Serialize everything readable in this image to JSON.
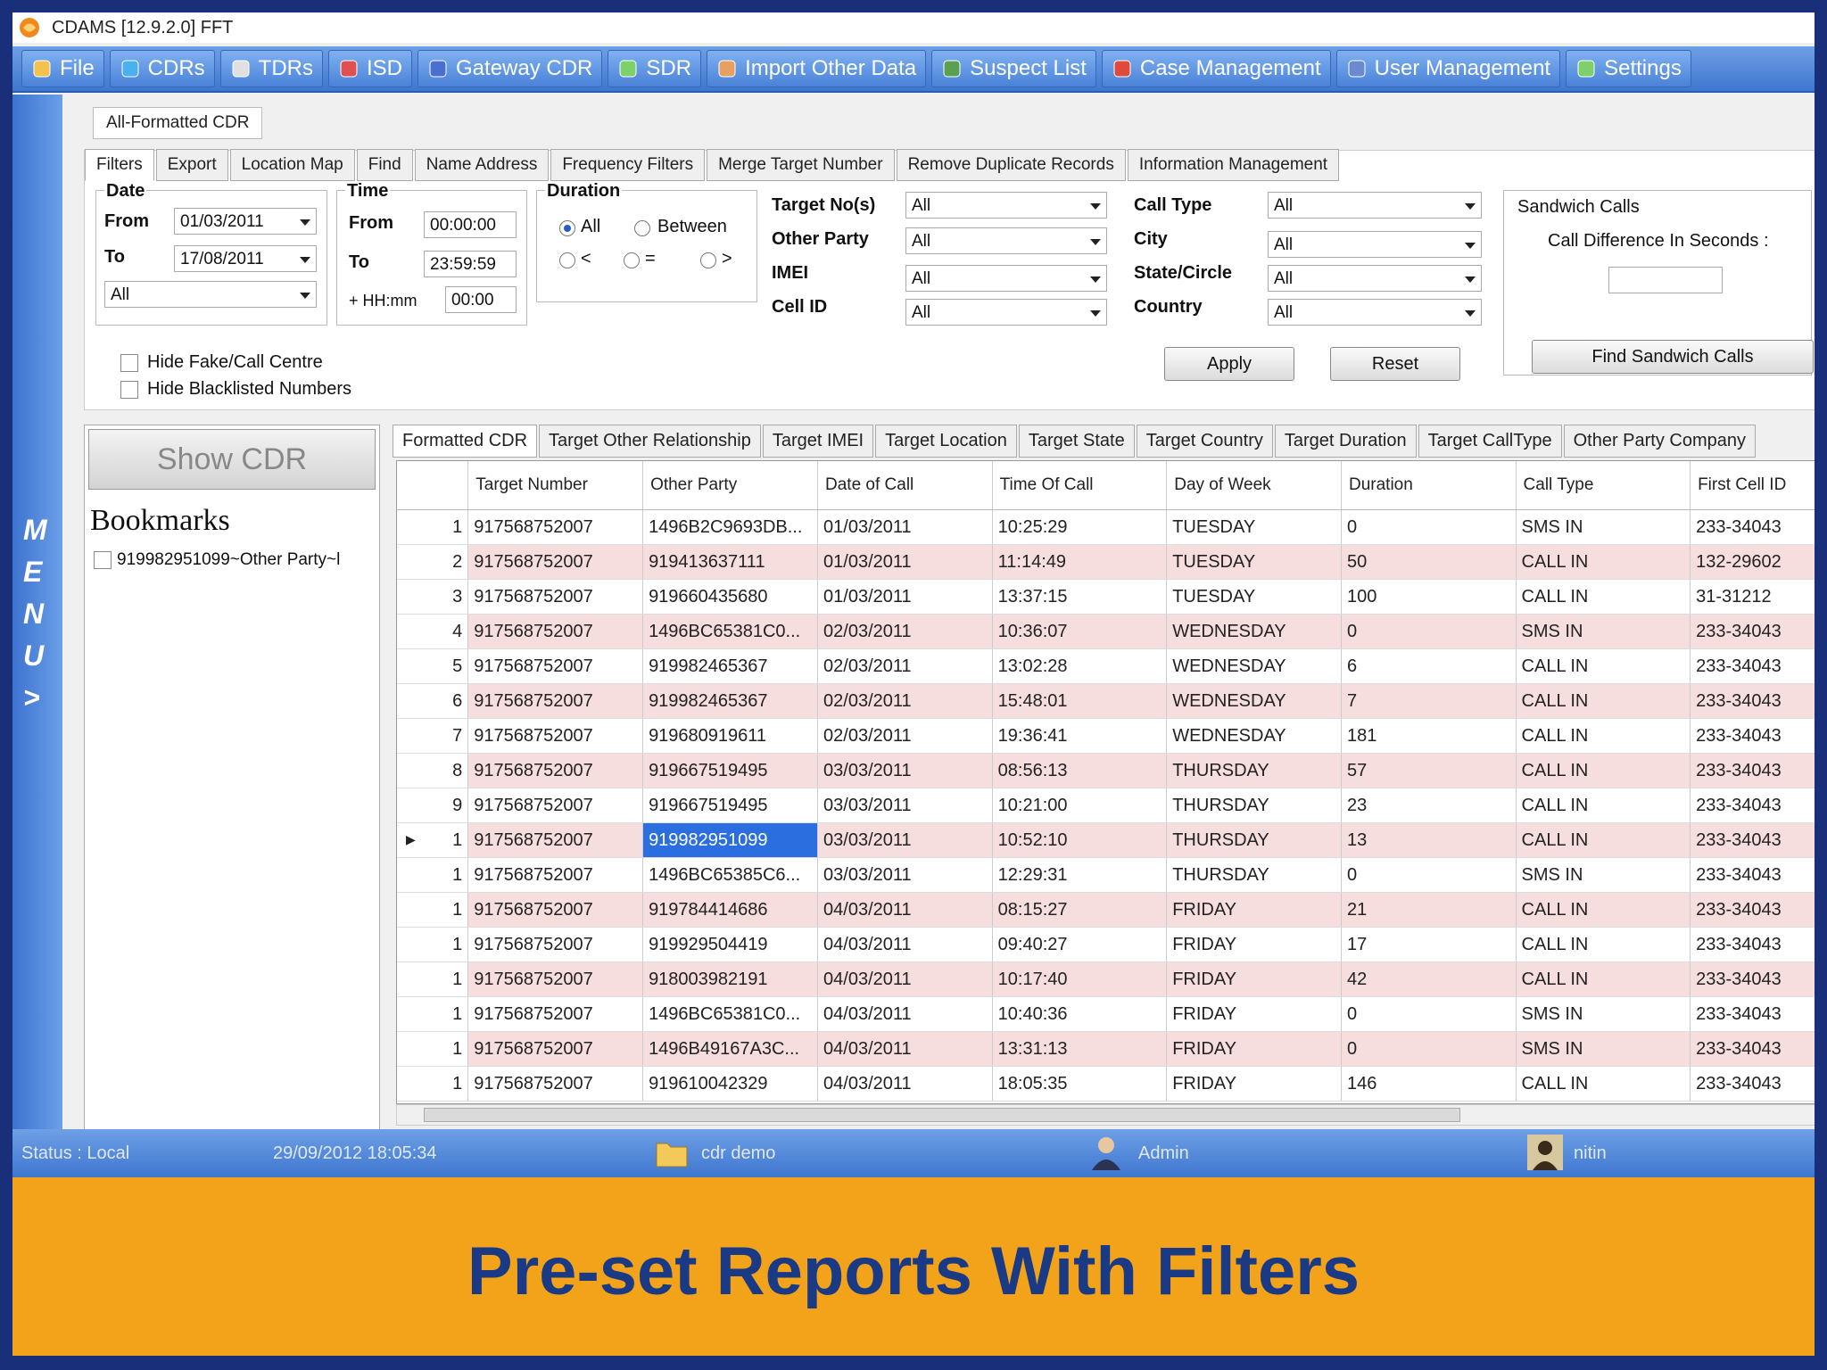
{
  "window": {
    "title": "CDAMS [12.9.2.0]  FFT"
  },
  "menubar": {
    "items": [
      {
        "label": "File",
        "icon": "folder-icon"
      },
      {
        "label": "CDRs",
        "icon": "phone-icon"
      },
      {
        "label": "TDRs",
        "icon": "tower-icon"
      },
      {
        "label": "ISD",
        "icon": "globe-icon"
      },
      {
        "label": "Gateway CDR",
        "icon": "gateway-icon"
      },
      {
        "label": "SDR",
        "icon": "sdr-icon"
      },
      {
        "label": "Import Other Data",
        "icon": "import-icon"
      },
      {
        "label": "Suspect List",
        "icon": "suspect-icon"
      },
      {
        "label": "Case Management",
        "icon": "case-icon"
      },
      {
        "label": "User Management",
        "icon": "users-icon"
      },
      {
        "label": "Settings",
        "icon": "gear-icon"
      }
    ]
  },
  "side_menu": {
    "letters": [
      "M",
      "E",
      "N",
      "U",
      ">"
    ]
  },
  "document_tab": "All-Formatted CDR",
  "filter_tabs": [
    "Filters",
    "Export",
    "Location Map",
    "Find",
    "Name Address",
    "Frequency Filters",
    "Merge Target Number",
    "Remove Duplicate Records",
    "Information Management"
  ],
  "filters": {
    "date": {
      "label": "Date",
      "from_label": "From",
      "from": "01/03/2011",
      "to_label": "To",
      "to": "17/08/2011",
      "range": "All"
    },
    "time": {
      "label": "Time",
      "from_label": "From",
      "from": "00:00:00",
      "to_label": "To",
      "to": "23:59:59",
      "hhmm_label": "+ HH:mm",
      "hhmm": "00:00"
    },
    "duration": {
      "label": "Duration",
      "all": "All",
      "between": "Between",
      "lt": "<",
      "eq": "=",
      "gt": ">"
    },
    "target_no": {
      "label": "Target No(s)",
      "value": "All"
    },
    "other_party": {
      "label": "Other Party",
      "value": "All"
    },
    "imei": {
      "label": "IMEI",
      "value": "All"
    },
    "cell_id": {
      "label": "Cell ID",
      "value": "All"
    },
    "call_type": {
      "label": "Call Type",
      "value": "All"
    },
    "city": {
      "label": "City",
      "value": "All"
    },
    "state_circle": {
      "label": "State/Circle",
      "value": "All"
    },
    "country": {
      "label": "Country",
      "value": "All"
    },
    "apply": "Apply",
    "reset": "Reset",
    "hide_fake": "Hide Fake/Call Centre",
    "hide_blacklisted": "Hide Blacklisted Numbers",
    "sandwich": {
      "title": "Sandwich Calls",
      "diff_label": "Call Difference In Seconds :",
      "button": "Find Sandwich Calls"
    }
  },
  "left_pane": {
    "show_cdr": "Show CDR",
    "bookmarks_title": "Bookmarks",
    "bookmark_item": "919982951099~Other Party~l"
  },
  "result_tabs": [
    "Formatted CDR",
    "Target Other Relationship",
    "Target IMEI",
    "Target Location",
    "Target State",
    "Target Country",
    "Target Duration",
    "Target CallType",
    "Other Party Company"
  ],
  "table": {
    "columns": [
      "Target Number",
      "Other Party",
      "Date of Call",
      "Time Of Call",
      "Day of Week",
      "Duration",
      "Call Type",
      "First Cell ID"
    ],
    "rows": [
      [
        "1",
        "917568752007",
        "1496B2C9693DB...",
        "01/03/2011",
        "10:25:29",
        "TUESDAY",
        "0",
        "SMS IN",
        "233-34043"
      ],
      [
        "2",
        "917568752007",
        "919413637111",
        "01/03/2011",
        "11:14:49",
        "TUESDAY",
        "50",
        "CALL IN",
        "132-29602"
      ],
      [
        "3",
        "917568752007",
        "919660435680",
        "01/03/2011",
        "13:37:15",
        "TUESDAY",
        "100",
        "CALL IN",
        "31-31212"
      ],
      [
        "4",
        "917568752007",
        "1496BC65381C0...",
        "02/03/2011",
        "10:36:07",
        "WEDNESDAY",
        "0",
        "SMS IN",
        "233-34043"
      ],
      [
        "5",
        "917568752007",
        "919982465367",
        "02/03/2011",
        "13:02:28",
        "WEDNESDAY",
        "6",
        "CALL IN",
        "233-34043"
      ],
      [
        "6",
        "917568752007",
        "919982465367",
        "02/03/2011",
        "15:48:01",
        "WEDNESDAY",
        "7",
        "CALL IN",
        "233-34043"
      ],
      [
        "7",
        "917568752007",
        "919680919611",
        "02/03/2011",
        "19:36:41",
        "WEDNESDAY",
        "181",
        "CALL IN",
        "233-34043"
      ],
      [
        "8",
        "917568752007",
        "919667519495",
        "03/03/2011",
        "08:56:13",
        "THURSDAY",
        "57",
        "CALL IN",
        "233-34043"
      ],
      [
        "9",
        "917568752007",
        "919667519495",
        "03/03/2011",
        "10:21:00",
        "THURSDAY",
        "23",
        "CALL IN",
        "233-34043"
      ],
      [
        "1",
        "917568752007",
        "919982951099",
        "03/03/2011",
        "10:52:10",
        "THURSDAY",
        "13",
        "CALL IN",
        "233-34043"
      ],
      [
        "1",
        "917568752007",
        "1496BC65385C6...",
        "03/03/2011",
        "12:29:31",
        "THURSDAY",
        "0",
        "SMS IN",
        "233-34043"
      ],
      [
        "1",
        "917568752007",
        "919784414686",
        "04/03/2011",
        "08:15:27",
        "FRIDAY",
        "21",
        "CALL IN",
        "233-34043"
      ],
      [
        "1",
        "917568752007",
        "919929504419",
        "04/03/2011",
        "09:40:27",
        "FRIDAY",
        "17",
        "CALL IN",
        "233-34043"
      ],
      [
        "1",
        "917568752007",
        "918003982191",
        "04/03/2011",
        "10:17:40",
        "FRIDAY",
        "42",
        "CALL IN",
        "233-34043"
      ],
      [
        "1",
        "917568752007",
        "1496BC65381C0...",
        "04/03/2011",
        "10:40:36",
        "FRIDAY",
        "0",
        "SMS IN",
        "233-34043"
      ],
      [
        "1",
        "917568752007",
        "1496B49167A3C...",
        "04/03/2011",
        "13:31:13",
        "FRIDAY",
        "0",
        "SMS IN",
        "233-34043"
      ],
      [
        "1",
        "917568752007",
        "919610042329",
        "04/03/2011",
        "18:05:35",
        "FRIDAY",
        "146",
        "CALL IN",
        "233-34043"
      ]
    ],
    "selected_row": 9,
    "selected_col": 1
  },
  "status": {
    "mode": "Status : Local",
    "datetime": "29/09/2012 18:05:34",
    "case": "cdr demo",
    "role": "Admin",
    "user": "nitin"
  },
  "banner": {
    "text": "Pre-set Reports With Filters"
  }
}
